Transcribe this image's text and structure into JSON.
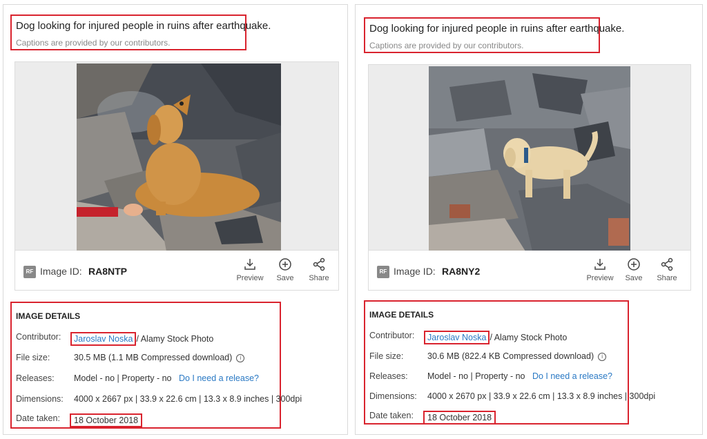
{
  "panels": [
    {
      "caption_title": "Dog looking for injured people in ruins after earthquake.",
      "caption_sub": "Captions are provided by our contributors.",
      "rf_badge": "RF",
      "image_id_label": "Image ID:",
      "image_id_value": "RA8NTP",
      "actions": {
        "preview": "Preview",
        "save": "Save",
        "share": "Share"
      },
      "details": {
        "title": "IMAGE DETAILS",
        "contributor_label": "Contributor:",
        "contributor_name": "Jaroslav Noska",
        "contributor_suffix": "/ Alamy Stock Photo",
        "file_size_label": "File size:",
        "file_size_value": "30.5 MB (1.1 MB Compressed download)",
        "releases_label": "Releases:",
        "releases_value": "Model - no | Property - no",
        "releases_link": "Do I need a release?",
        "dimensions_label": "Dimensions:",
        "dimensions_value": "4000 x 2667 px | 33.9 x 22.6 cm | 13.3 x 8.9 inches | 300dpi",
        "date_label": "Date taken:",
        "date_value": "18 October 2018"
      }
    },
    {
      "caption_title": "Dog looking for injured people in ruins after earthquake.",
      "caption_sub": "Captions are provided by our contributors.",
      "rf_badge": "RF",
      "image_id_label": "Image ID:",
      "image_id_value": "RA8NY2",
      "actions": {
        "preview": "Preview",
        "save": "Save",
        "share": "Share"
      },
      "details": {
        "title": "IMAGE DETAILS",
        "contributor_label": "Contributor:",
        "contributor_name": "Jaroslav Noska",
        "contributor_suffix": "/ Alamy Stock Photo",
        "file_size_label": "File size:",
        "file_size_value": "30.6 MB (822.4 KB Compressed download)",
        "releases_label": "Releases:",
        "releases_value": "Model - no | Property - no",
        "releases_link": "Do I need a release?",
        "dimensions_label": "Dimensions:",
        "dimensions_value": "4000 x 2670 px | 33.9 x 22.6 cm | 13.3 x 8.9 inches | 300dpi",
        "date_label": "Date taken:",
        "date_value": "18 October 2018"
      }
    }
  ],
  "colors": {
    "highlight": "#d9232e",
    "link": "#2a79c4",
    "dog_fur": "#c98a3c",
    "rubble": "#6f7378"
  },
  "icons": {
    "preview": "download-icon",
    "save": "plus-circle-icon",
    "share": "share-icon",
    "info": "info-icon"
  }
}
